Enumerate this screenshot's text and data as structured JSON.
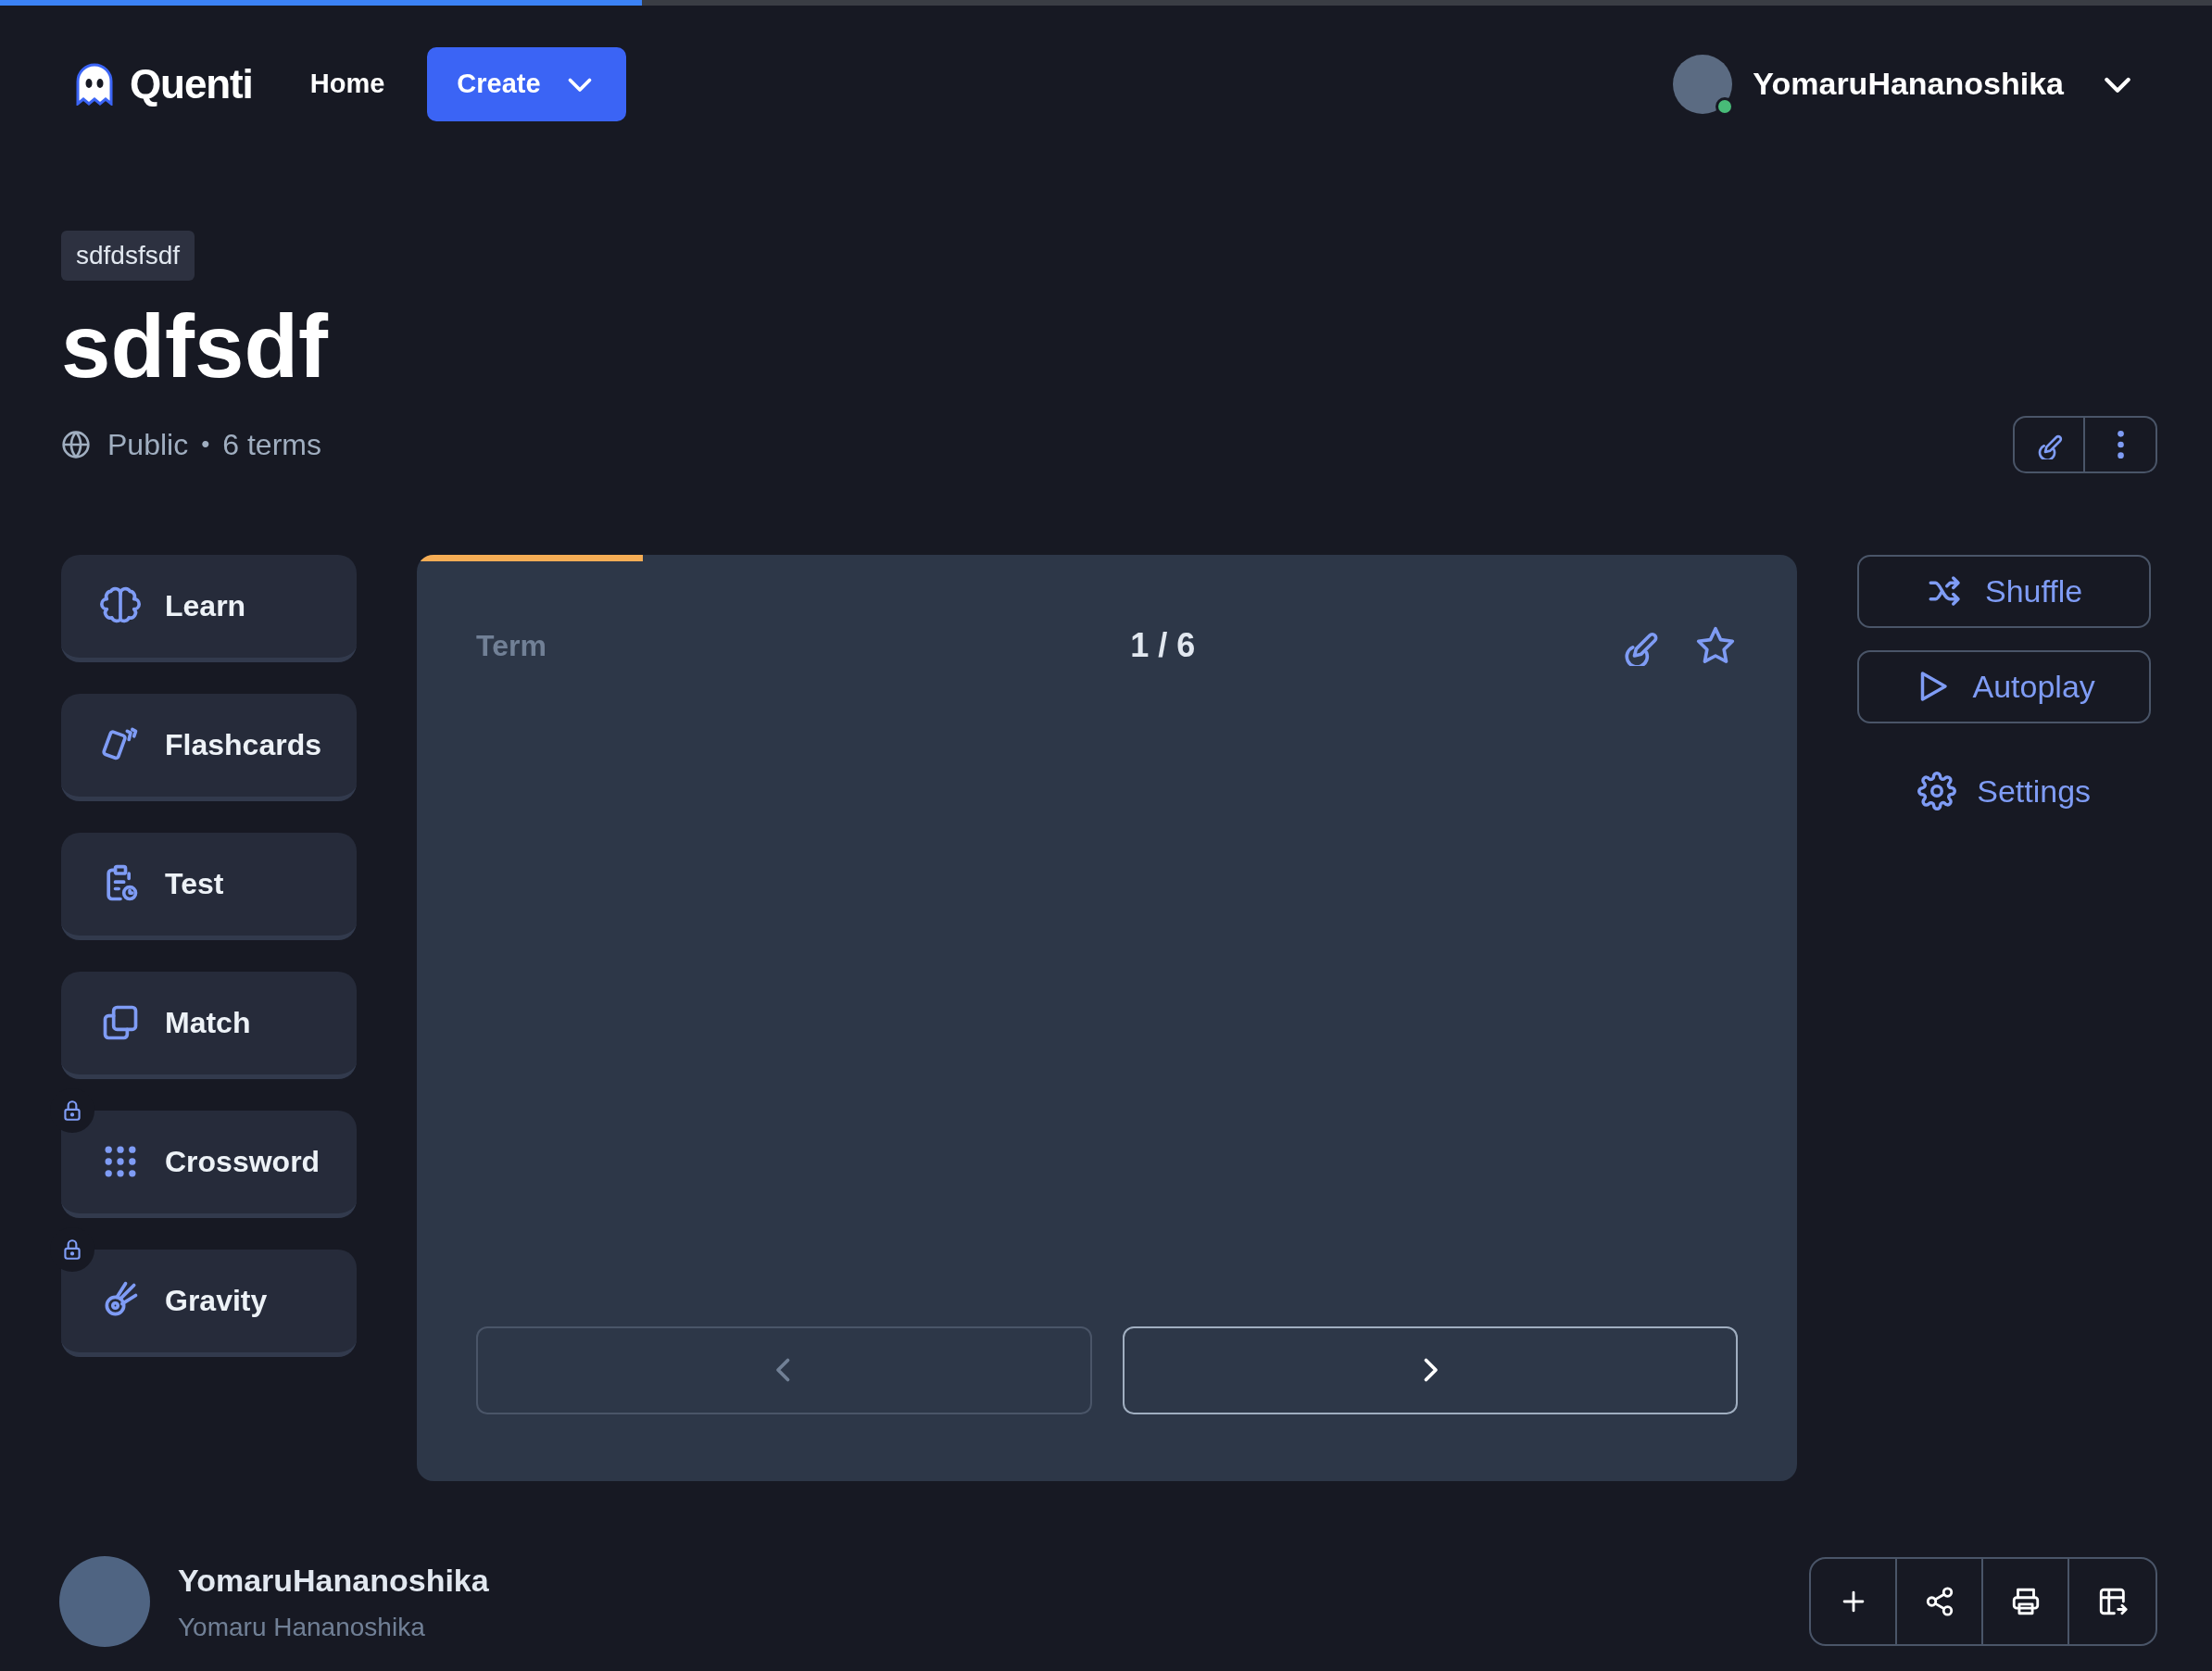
{
  "loading_bar": {
    "level": 0.29
  },
  "header": {
    "brand": "Quenti",
    "nav": [
      {
        "label": "Home",
        "kind": "link"
      },
      {
        "label": "Create",
        "kind": "dropdown"
      }
    ],
    "user": {
      "name": "YomaruHananoshika",
      "online": true
    }
  },
  "set": {
    "folder": "sdfdsfsdf",
    "title": "sdfsdf",
    "visibility": "Public",
    "separator": "•",
    "terms": "6 terms"
  },
  "modes": [
    {
      "label": "Learn",
      "locked": false
    },
    {
      "label": "Flashcards",
      "locked": false
    },
    {
      "label": "Test",
      "locked": false
    },
    {
      "label": "Match",
      "locked": false
    },
    {
      "label": "Crossword",
      "locked": true
    },
    {
      "label": "Gravity",
      "locked": true
    }
  ],
  "card": {
    "progress": {
      "level": 0.164
    },
    "side": "Term",
    "counter": "1 / 6",
    "starred": false,
    "nav_buttons": [
      {
        "disabled": true
      },
      {
        "disabled": false
      }
    ]
  },
  "actions": [
    {
      "label": "Shuffle",
      "kind": "outlined"
    },
    {
      "label": "Autoplay",
      "kind": "outlined"
    },
    {
      "label": "Settings",
      "kind": "plain"
    }
  ],
  "footer": {
    "name": "YomaruHananoshika",
    "full_name": "Yomaru Hananoshika"
  }
}
